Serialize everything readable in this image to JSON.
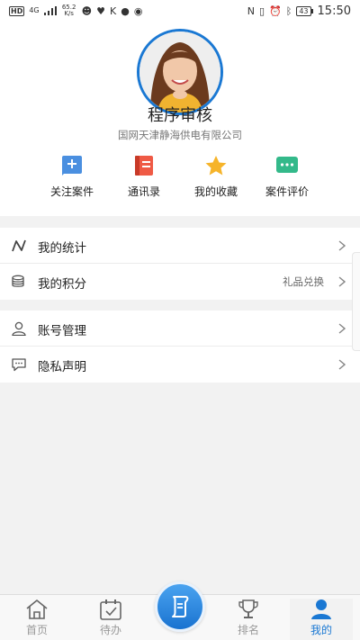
{
  "status_bar": {
    "hd": "HD",
    "signal": "4G",
    "speed": "65.2 K/s",
    "battery": "43",
    "time": "15:50"
  },
  "profile": {
    "name": "程序审核",
    "organization": "国网天津静海供电有限公司"
  },
  "quick_actions": [
    {
      "label": "关注案件",
      "icon": "bookmark-plus-icon",
      "color": "#4a8fe0"
    },
    {
      "label": "通讯录",
      "icon": "contacts-book-icon",
      "color": "#ef5a45"
    },
    {
      "label": "我的收藏",
      "icon": "star-icon",
      "color": "#f6b42a"
    },
    {
      "label": "案件评价",
      "icon": "chat-bubble-icon",
      "color": "#33b98a"
    }
  ],
  "menu_group_1": [
    {
      "label": "我的统计",
      "icon": "trend-line-icon"
    },
    {
      "label": "我的积分",
      "icon": "coins-stack-icon",
      "extra": "礼品兑换"
    }
  ],
  "menu_group_2": [
    {
      "label": "账号管理",
      "icon": "user-icon"
    },
    {
      "label": "隐私声明",
      "icon": "message-icon"
    }
  ],
  "bottom_nav": [
    {
      "label": "首页",
      "icon": "home-icon"
    },
    {
      "label": "待办",
      "icon": "calendar-check-icon"
    },
    {
      "label": "排名",
      "icon": "trophy-icon"
    },
    {
      "label": "我的",
      "icon": "profile-icon",
      "active": true
    }
  ],
  "colors": {
    "accent": "#1a78d3",
    "background": "#f2f2f2"
  }
}
